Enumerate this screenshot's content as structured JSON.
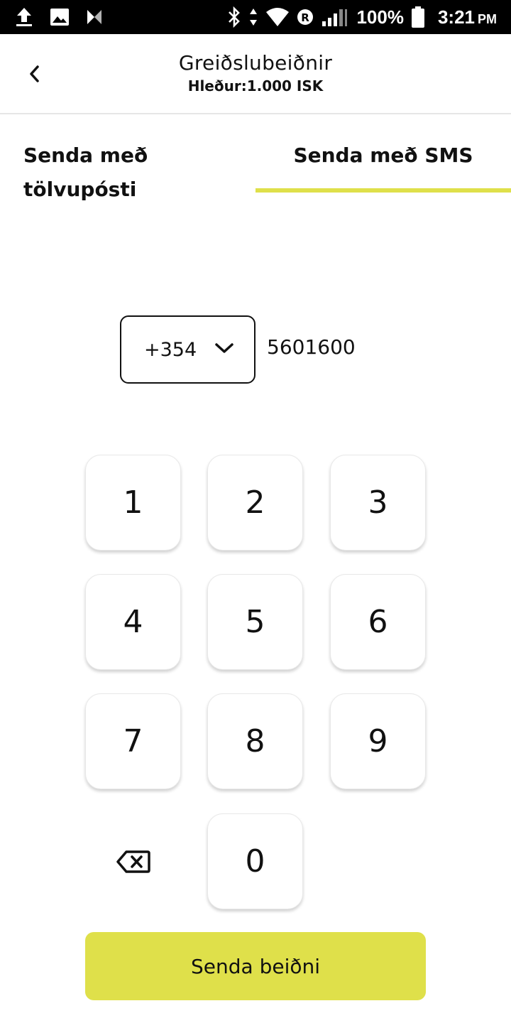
{
  "status_bar": {
    "battery": "100%",
    "time": "3:21",
    "ampm": "PM",
    "icons": [
      "upload-icon",
      "image-icon",
      "app-notification-icon",
      "bluetooth-icon",
      "data-arrows-icon",
      "wifi-icon",
      "roaming-icon",
      "signal-icon",
      "battery-icon"
    ]
  },
  "header": {
    "title": "Greiðslubeiðnir",
    "subtitle": "Hleður:1.000 ISK",
    "back_icon": "chevron-left-icon"
  },
  "tabs": [
    {
      "line1": "Senda með",
      "line2": "tölvupósti",
      "active": false
    },
    {
      "label": "Senda með SMS",
      "active": true
    }
  ],
  "phone": {
    "country_code": "+354",
    "number": "5601600"
  },
  "keypad": {
    "keys": [
      "1",
      "2",
      "3",
      "4",
      "5",
      "6",
      "7",
      "8",
      "9",
      "0"
    ],
    "backspace_icon": "backspace-icon"
  },
  "send_button": {
    "label": "Senda beiðni"
  },
  "colors": {
    "accent": "#dfe04a",
    "text": "#111111",
    "status_bar": "#000000"
  }
}
